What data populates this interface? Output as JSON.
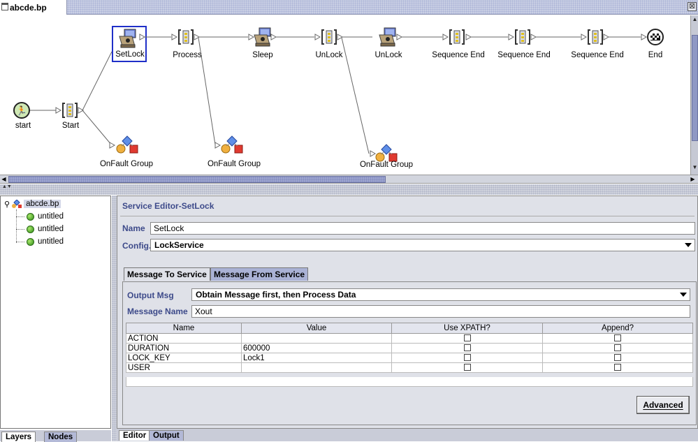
{
  "window": {
    "tab_title": "abcde.bp",
    "close_glyph": "⊠"
  },
  "canvas": {
    "nodes": [
      {
        "id": "start_circle",
        "label": "start",
        "icon": "run-icon"
      },
      {
        "id": "start_seq",
        "label": "Start",
        "icon": "sequence-icon"
      },
      {
        "id": "setlock",
        "label": "SetLock",
        "icon": "service-icon"
      },
      {
        "id": "process",
        "label": "Process",
        "icon": "sequence-icon"
      },
      {
        "id": "sleep",
        "label": "Sleep",
        "icon": "service-icon"
      },
      {
        "id": "unlock_seq",
        "label": "UnLock",
        "icon": "sequence-icon"
      },
      {
        "id": "unlock_svc",
        "label": "UnLock",
        "icon": "service-icon"
      },
      {
        "id": "seq_end_1",
        "label": "Sequence End",
        "icon": "sequence-icon"
      },
      {
        "id": "seq_end_2",
        "label": "Sequence End",
        "icon": "sequence-icon"
      },
      {
        "id": "seq_end_3",
        "label": "Sequence End",
        "icon": "sequence-icon"
      },
      {
        "id": "end",
        "label": "End",
        "icon": "checkered-flag-icon"
      },
      {
        "id": "onfault_1",
        "label": "OnFault Group",
        "icon": "onfault-group-icon"
      },
      {
        "id": "onfault_2",
        "label": "OnFault Group",
        "icon": "onfault-group-icon"
      },
      {
        "id": "onfault_3",
        "label": "OnFault Group",
        "icon": "onfault-group-icon"
      }
    ]
  },
  "tree": {
    "root": "abcde.bp",
    "items": [
      "untitled",
      "untitled",
      "untitled"
    ]
  },
  "left_tabs": [
    "Layers",
    "Nodes"
  ],
  "bottom_tabs": [
    "Editor",
    "Output"
  ],
  "editor": {
    "title": "Service Editor-SetLock",
    "name_label": "Name",
    "name_value": "SetLock",
    "config_label": "Config.",
    "config_value": "LockService",
    "tabs": [
      "Message To Service",
      "Message From Service"
    ],
    "output_msg_label": "Output Msg",
    "output_msg_value": "Obtain Message first, then Process Data",
    "message_name_label": "Message Name",
    "message_name_value": "Xout",
    "columns": [
      "Name",
      "Value",
      "Use XPATH?",
      "Append?"
    ],
    "rows": [
      {
        "name": "ACTION",
        "value": "",
        "use_xpath": false,
        "append": false
      },
      {
        "name": "DURATION",
        "value": "600000",
        "use_xpath": false,
        "append": false
      },
      {
        "name": "LOCK_KEY",
        "value": "Lock1",
        "use_xpath": false,
        "append": false
      },
      {
        "name": "USER",
        "value": "",
        "use_xpath": false,
        "append": false
      }
    ],
    "advanced_button": "Advanced"
  },
  "colors": {
    "accent_label": "#3d4a8a",
    "selection_box": "#1f2fc8",
    "inactive_tab": "#aab2d5"
  }
}
